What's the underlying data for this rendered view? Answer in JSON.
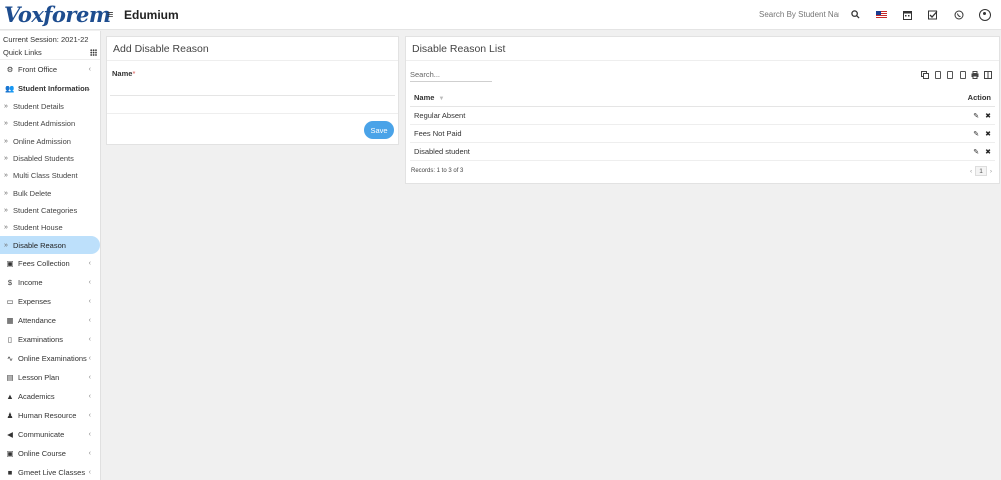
{
  "header": {
    "logo_text": "Voxforem",
    "app_name": "Edumium",
    "search_placeholder": "Search By Student Name",
    "icons": [
      "menu-icon",
      "search-icon",
      "us-flag-icon",
      "calendar-icon",
      "checkbox-icon",
      "whatsapp-icon",
      "user-avatar-icon"
    ]
  },
  "sidebar": {
    "session": "Current Session: 2021-22",
    "quick_links": "Quick Links",
    "items": [
      {
        "label": "Front Office",
        "icon": "⚙",
        "arrow": "‹"
      },
      {
        "label": "Student Information",
        "icon": "👥",
        "arrow": "⌄"
      }
    ],
    "sub_items": [
      {
        "label": "Student Details"
      },
      {
        "label": "Student Admission"
      },
      {
        "label": "Online Admission"
      },
      {
        "label": "Disabled Students"
      },
      {
        "label": "Multi Class Student"
      },
      {
        "label": "Bulk Delete"
      },
      {
        "label": "Student Categories"
      },
      {
        "label": "Student House"
      },
      {
        "label": "Disable Reason"
      }
    ],
    "bottom_items": [
      {
        "label": "Fees Collection",
        "icon": "▣",
        "arrow": "‹"
      },
      {
        "label": "Income",
        "icon": "$",
        "arrow": "‹"
      },
      {
        "label": "Expenses",
        "icon": "▭",
        "arrow": "‹"
      },
      {
        "label": "Attendance",
        "icon": "▦",
        "arrow": "‹"
      },
      {
        "label": "Examinations",
        "icon": "▯",
        "arrow": "‹"
      },
      {
        "label": "Online Examinations",
        "icon": "∿",
        "arrow": "‹"
      },
      {
        "label": "Lesson Plan",
        "icon": "▤",
        "arrow": "‹"
      },
      {
        "label": "Academics",
        "icon": "▲",
        "arrow": "‹"
      },
      {
        "label": "Human Resource",
        "icon": "♟",
        "arrow": "‹"
      },
      {
        "label": "Communicate",
        "icon": "◀",
        "arrow": "‹"
      },
      {
        "label": "Online Course",
        "icon": "▣",
        "arrow": "‹"
      },
      {
        "label": "Gmeet Live Classes",
        "icon": "■",
        "arrow": "‹"
      }
    ]
  },
  "add_form": {
    "title": "Add Disable Reason",
    "name_label": "Name",
    "required_mark": "*",
    "name_value": "",
    "save_label": "Save"
  },
  "list": {
    "title": "Disable Reason List",
    "search_placeholder": "Search...",
    "col_name": "Name",
    "col_action": "Action",
    "rows": [
      {
        "name": "Regular Absent"
      },
      {
        "name": "Fees Not Paid"
      },
      {
        "name": "Disabled student"
      }
    ],
    "records": "Records: 1 to 3 of 3",
    "page": "1",
    "prev": "‹",
    "next": "›"
  }
}
